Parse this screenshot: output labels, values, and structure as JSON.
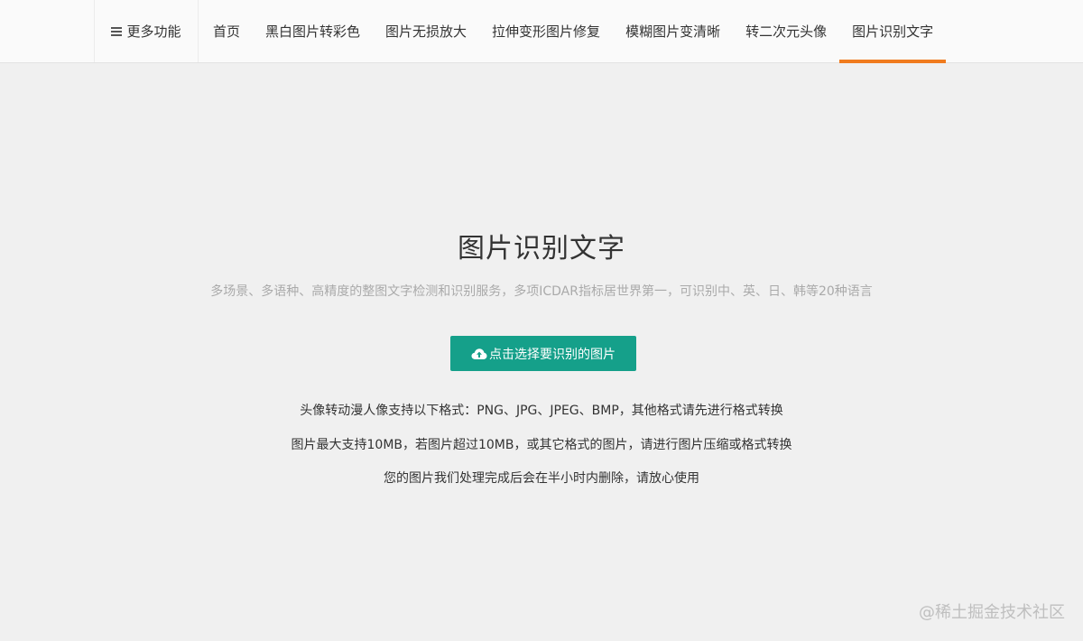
{
  "nav": {
    "more_label": "更多功能",
    "items": [
      {
        "label": "首页"
      },
      {
        "label": "黑白图片转彩色"
      },
      {
        "label": "图片无损放大"
      },
      {
        "label": "拉伸变形图片修复"
      },
      {
        "label": "模糊图片变清晰"
      },
      {
        "label": "转二次元头像"
      },
      {
        "label": "图片识别文字",
        "active": true
      }
    ]
  },
  "hero": {
    "title": "图片识别文字",
    "subtitle": "多场景、多语种、高精度的整图文字检测和识别服务，多项ICDAR指标居世界第一，可识别中、英、日、韩等20种语言",
    "upload_label": "点击选择要识别的图片"
  },
  "info": {
    "line1": "头像转动漫人像支持以下格式：PNG、JPG、JPEG、BMP，其他格式请先进行格式转换",
    "line2": "图片最大支持10MB，若图片超过10MB，或其它格式的图片，请进行图片压缩或格式转换",
    "line3": "您的图片我们处理完成后会在半小时内删除，请放心使用"
  },
  "watermark": "@稀土掘金技术社区",
  "colors": {
    "accent_orange": "#f07b1e",
    "button_teal": "#15a08a",
    "background": "#f0f0f0"
  },
  "icons": {
    "menu": "hamburger-icon",
    "upload": "cloud-upload-icon"
  }
}
